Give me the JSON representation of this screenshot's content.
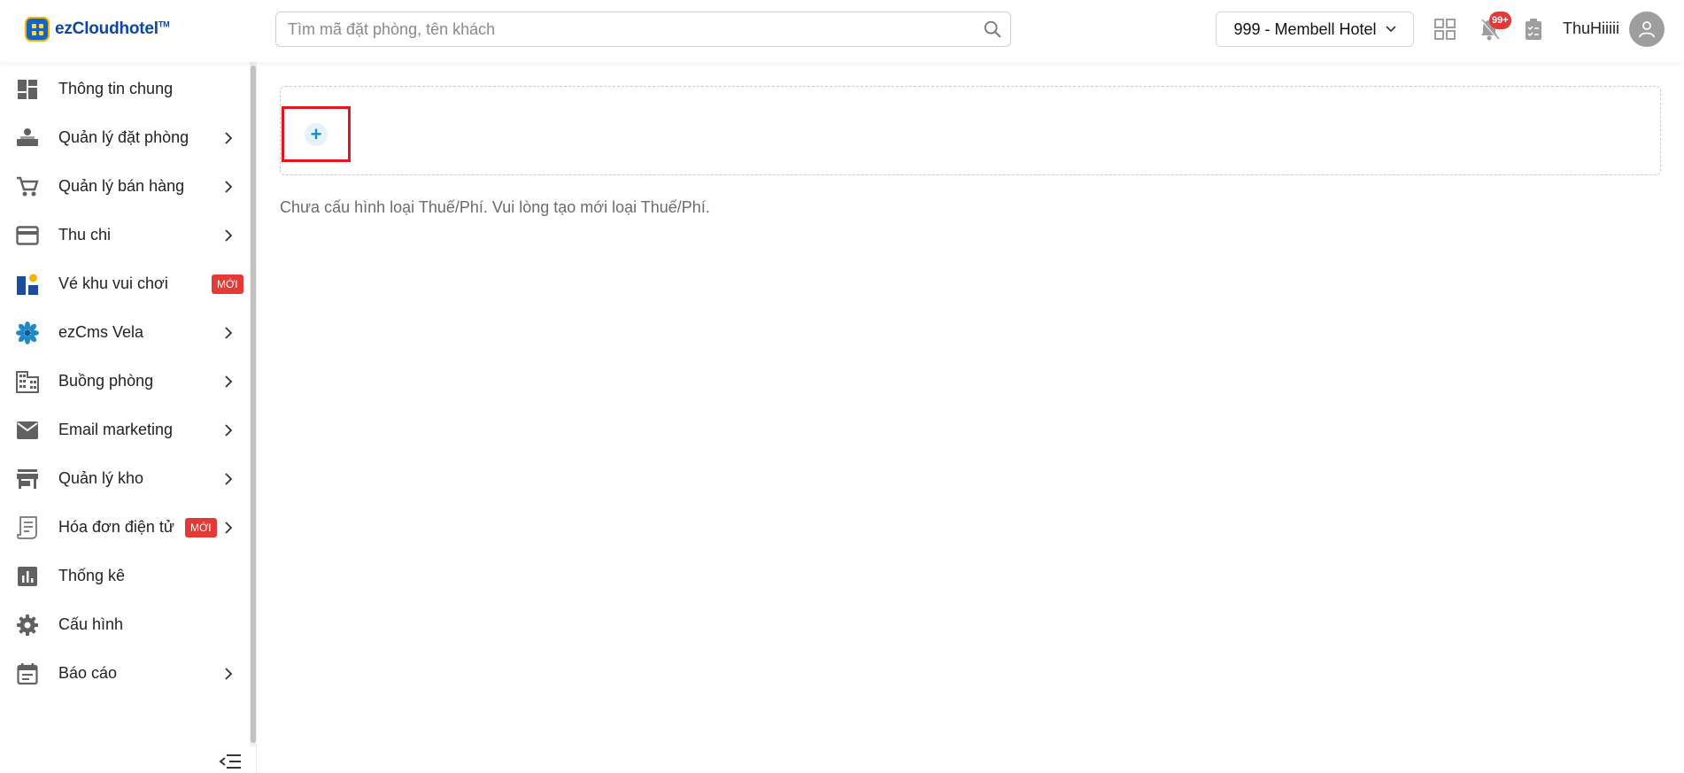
{
  "header": {
    "logo_text": "ezCloudhotel",
    "logo_tm": "TM",
    "search_placeholder": "Tìm mã đặt phòng, tên khách",
    "hotel_selector": "999 - Membell Hotel",
    "notification_count": "99+",
    "username": "ThuHiiiii"
  },
  "sidebar": {
    "items": [
      {
        "label": "Thông tin chung",
        "icon": "dashboard-icon",
        "chevron": false
      },
      {
        "label": "Quản lý đặt phòng",
        "icon": "reception-icon",
        "chevron": true
      },
      {
        "label": "Quản lý bán hàng",
        "icon": "cart-icon",
        "chevron": true
      },
      {
        "label": "Thu chi",
        "icon": "credit-card-icon",
        "chevron": true
      },
      {
        "label": "Vé khu vui chơi",
        "icon": "amusement-icon",
        "chevron": false,
        "badge": "MỚI"
      },
      {
        "label": "ezCms Vela",
        "icon": "flower-icon",
        "chevron": true
      },
      {
        "label": "Buồng phòng",
        "icon": "building-icon",
        "chevron": true
      },
      {
        "label": "Email marketing",
        "icon": "mail-icon",
        "chevron": true
      },
      {
        "label": "Quản lý kho",
        "icon": "store-icon",
        "chevron": true
      },
      {
        "label": "Hóa đơn điện tử",
        "icon": "receipt-icon",
        "chevron": true,
        "badge": "MỚI"
      },
      {
        "label": "Thống kê",
        "icon": "bar-chart-icon",
        "chevron": false
      },
      {
        "label": "Cấu hình",
        "icon": "gear-icon",
        "chevron": false
      },
      {
        "label": "Báo cáo",
        "icon": "calendar-report-icon",
        "chevron": true
      }
    ]
  },
  "main": {
    "add_symbol": "+",
    "empty_message": "Chưa cấu hình loại Thuế/Phí. Vui lòng tạo mới loại Thuế/Phí."
  },
  "colors": {
    "accent_blue": "#1e88c8",
    "badge_red": "#e53935",
    "highlight_red": "#e3141c",
    "icon_gray": "#616161"
  }
}
